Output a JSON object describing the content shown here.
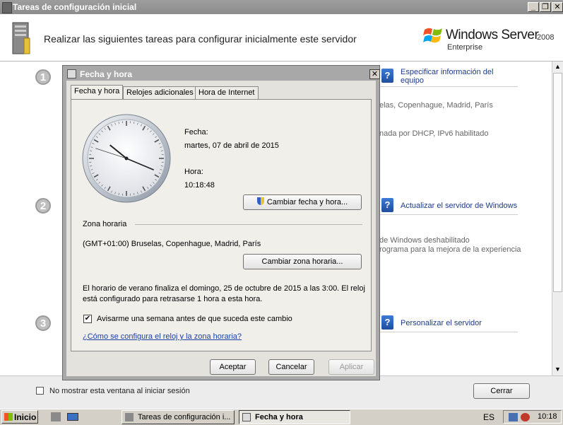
{
  "main_window": {
    "title": "Tareas de configuración inicial",
    "header_title": "Realizar las siguientes tareas para configurar inicialmente este servidor",
    "logo_text": "Windows Server",
    "logo_version": "2008",
    "logo_edition": "Enterprise",
    "steps": [
      "1",
      "2",
      "3"
    ],
    "right_panel": {
      "link1": "Especificar información del equipo",
      "text1": "elas, Copenhague, Madrid, París",
      "text2": "nada por DHCP, IPv6 habilitado",
      "link2": "Actualizar el servidor de Windows",
      "text3": "de Windows deshabilitado",
      "text4": "rograma para la mejora de la experiencia",
      "link3": "Personalizar el servidor"
    },
    "checkbox_label": "No mostrar esta ventana al iniciar sesión",
    "close_button": "Cerrar"
  },
  "dialog": {
    "title": "Fecha y hora",
    "tabs": [
      "Fecha y hora",
      "Relojes adicionales",
      "Hora de Internet"
    ],
    "date_label": "Fecha:",
    "date_value": "martes, 07 de abril de 2015",
    "time_label": "Hora:",
    "time_value": "10:18:48",
    "change_datetime_button": "Cambiar fecha y hora...",
    "timezone_header": "Zona horaria",
    "timezone_value": "(GMT+01:00) Bruselas, Copenhague, Madrid, París",
    "change_timezone_button": "Cambiar zona horaria...",
    "dst_text": "El horario de verano finaliza el domingo, 25 de octubre de 2015 a las 3:00. El reloj está configurado para retrasarse 1 hora a esta hora.",
    "notify_checkbox": "Avisarme una semana antes de que suceda este cambio",
    "notify_checked": true,
    "help_link": "¿Cómo se configura el reloj y la zona horaria?",
    "ok_button": "Aceptar",
    "cancel_button": "Cancelar",
    "apply_button": "Aplicar",
    "clock": {
      "hour": 10,
      "minute": 18,
      "second": 48
    }
  },
  "taskbar": {
    "start": "Inicio",
    "task1": "Tareas de configuración i...",
    "task2": "Fecha y hora",
    "lang": "ES",
    "clock": "10:18"
  }
}
